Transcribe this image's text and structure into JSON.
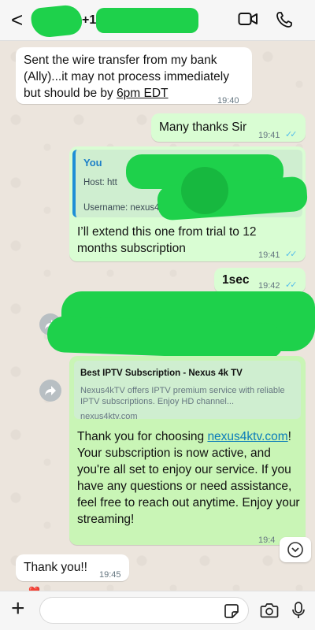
{
  "header": {
    "back_glyph": "<",
    "phone_prefix": "+1",
    "icons": [
      "back-arrow-icon",
      "video-call-icon",
      "phone-call-icon"
    ]
  },
  "messages": {
    "m1": {
      "text_a": "Sent the wire transfer from my bank (Ally)...it may not process immediately but should be by ",
      "text_b": "6pm EDT",
      "time": "19:40"
    },
    "m2": {
      "text": "Many thanks Sir",
      "time": "19:41"
    },
    "m3": {
      "quote_author": "You",
      "quote_host": "Host: htt",
      "quote_user": "Username: nexus4ktv",
      "text": "I’ll extend this one from trial to 12 months subscription",
      "time": "19:41"
    },
    "m4": {
      "text": "1sec",
      "time": "19:42"
    },
    "m6": {
      "preview_title": "Best IPTV Subscription - Nexus 4k TV",
      "preview_desc": "Nexus4kTV offers IPTV premium service with reliable IPTV subscriptions. Enjoy HD channel...",
      "preview_url": "nexus4ktv.com",
      "text_a": "Thank you for choosing ",
      "link": "nexus4ktv.com",
      "text_b": "! Your subscription is now active, and you're all set to enjoy our service. If you have any questions or need assistance, feel free to reach out anytime. Enjoy your streaming!",
      "time": "19:4"
    },
    "m7": {
      "text": "Thank you!!",
      "time": "19:45",
      "reaction": "❤️"
    }
  },
  "composer": {
    "value": "",
    "placeholder": ""
  },
  "colors": {
    "outgoing_bubble": "#d9fdd3",
    "incoming_bubble": "#ffffff",
    "redaction": "#1ed14b",
    "read_ticks": "#53bdeb"
  }
}
